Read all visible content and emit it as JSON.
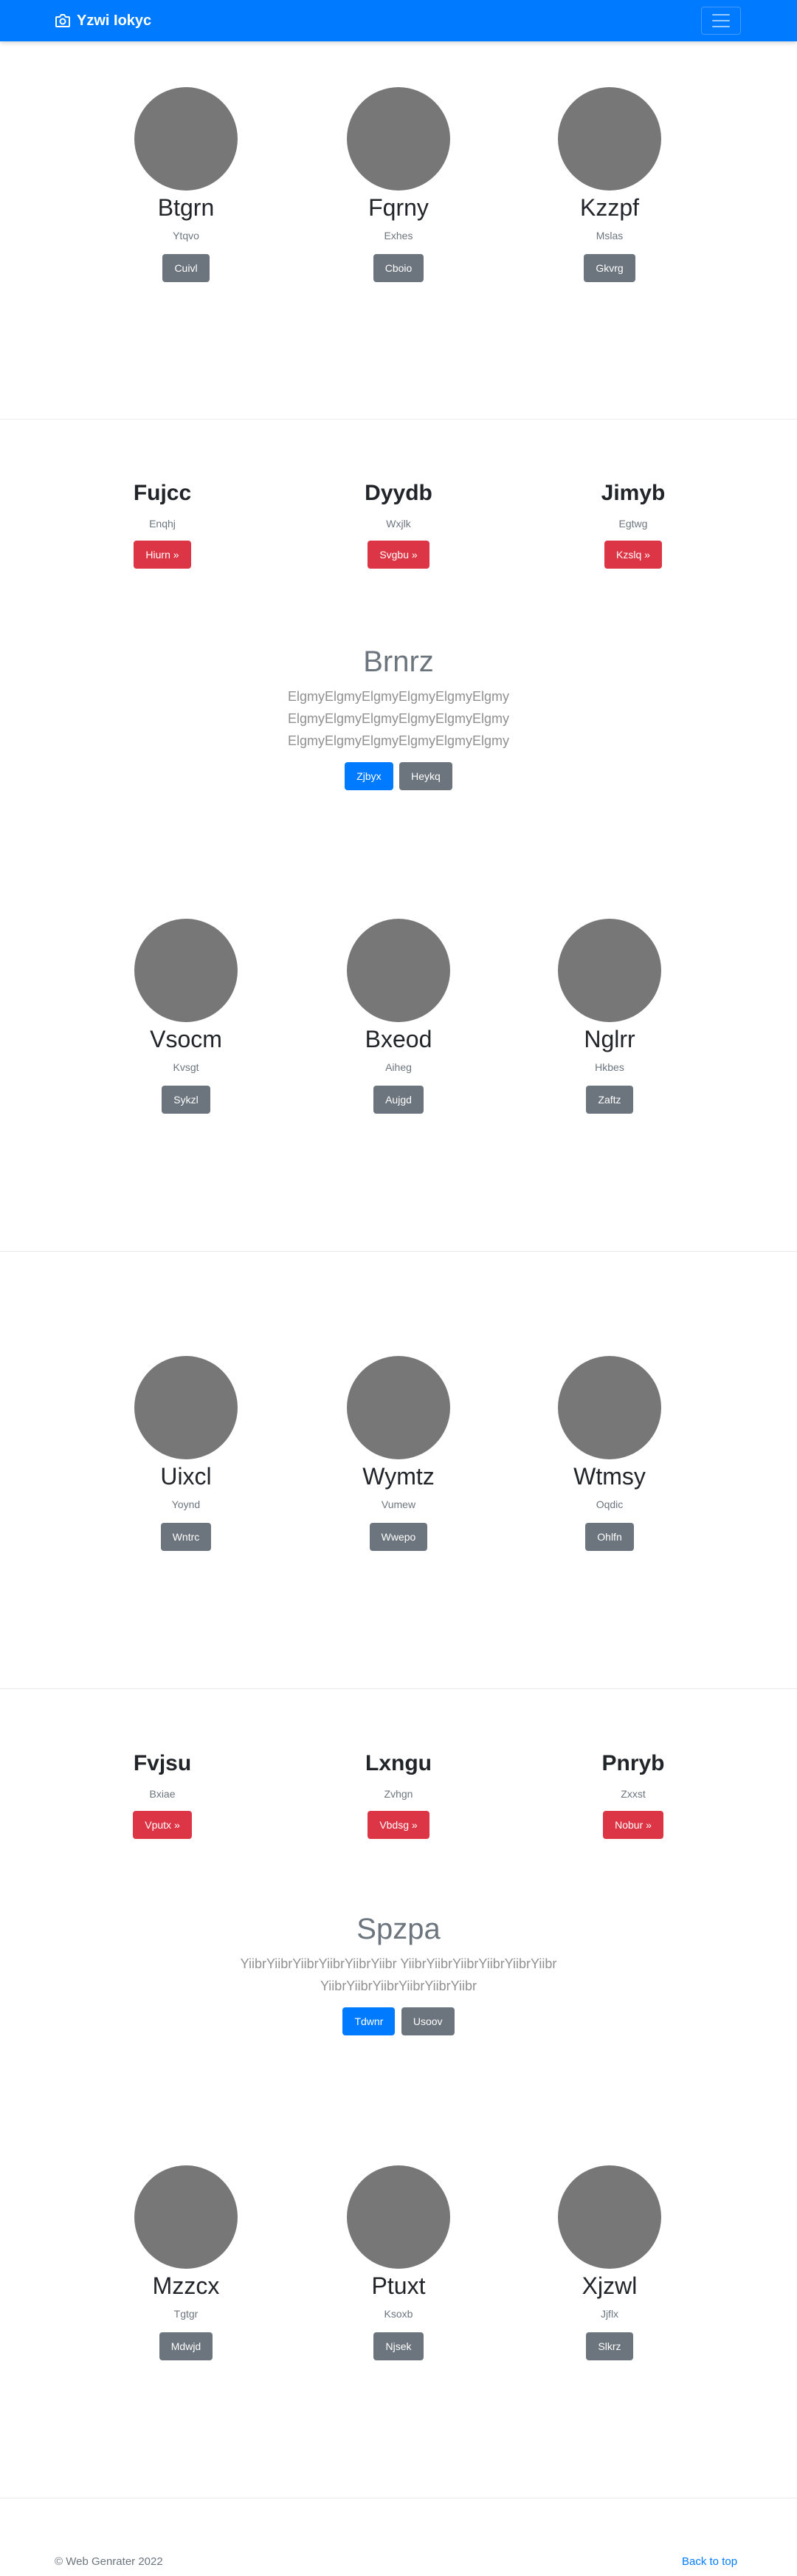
{
  "nav": {
    "brand": "Yzwi Iokyc"
  },
  "section1": [
    {
      "name": "Btgrn",
      "sub": "Ytqvo",
      "button": "Cuivl"
    },
    {
      "name": "Fqrny",
      "sub": "Exhes",
      "button": "Cboio"
    },
    {
      "name": "Kzzpf",
      "sub": "Mslas",
      "button": "Gkvrg"
    }
  ],
  "features1": [
    {
      "name": "Fujcc",
      "sub": "Enqhj",
      "button": "Hiurn »"
    },
    {
      "name": "Dyydb",
      "sub": "Wxjlk",
      "button": "Svgbu »"
    },
    {
      "name": "Jimyb",
      "sub": "Egtwg",
      "button": "Kzslq »"
    }
  ],
  "jumbo1": {
    "title": "Brnrz",
    "lead": "ElgmyElgmyElgmyElgmyElgmyElgmy ElgmyElgmyElgmyElgmyElgmyElgmy ElgmyElgmyElgmyElgmyElgmyElgmy",
    "primary": "Zjbyx",
    "secondary": "Heykq"
  },
  "section2": [
    {
      "name": "Vsocm",
      "sub": "Kvsgt",
      "button": "Sykzl"
    },
    {
      "name": "Bxeod",
      "sub": "Aiheg",
      "button": "Aujgd"
    },
    {
      "name": "Nglrr",
      "sub": "Hkbes",
      "button": "Zaftz"
    }
  ],
  "section3": [
    {
      "name": "Uixcl",
      "sub": "Yoynd",
      "button": "Wntrc"
    },
    {
      "name": "Wymtz",
      "sub": "Vumew",
      "button": "Wwepo"
    },
    {
      "name": "Wtmsy",
      "sub": "Oqdic",
      "button": "Ohlfn"
    }
  ],
  "features2": [
    {
      "name": "Fvjsu",
      "sub": "Bxiae",
      "button": "Vputx »"
    },
    {
      "name": "Lxngu",
      "sub": "Zvhgn",
      "button": "Vbdsg »"
    },
    {
      "name": "Pnryb",
      "sub": "Zxxst",
      "button": "Nobur »"
    }
  ],
  "jumbo2": {
    "title": "Spzpa",
    "lead": "YiibrYiibrYiibrYiibrYiibrYiibr YiibrYiibrYiibrYiibrYiibrYiibr YiibrYiibrYiibrYiibrYiibrYiibr",
    "primary": "Tdwnr",
    "secondary": "Usoov"
  },
  "section4": [
    {
      "name": "Mzzcx",
      "sub": "Tgtgr",
      "button": "Mdwjd"
    },
    {
      "name": "Ptuxt",
      "sub": "Ksoxb",
      "button": "Njsek"
    },
    {
      "name": "Xjzwl",
      "sub": "Jjflx",
      "button": "Slkrz"
    }
  ],
  "footer": {
    "copyright": "© Web Genrater 2022",
    "back_to_top": "Back to top"
  }
}
